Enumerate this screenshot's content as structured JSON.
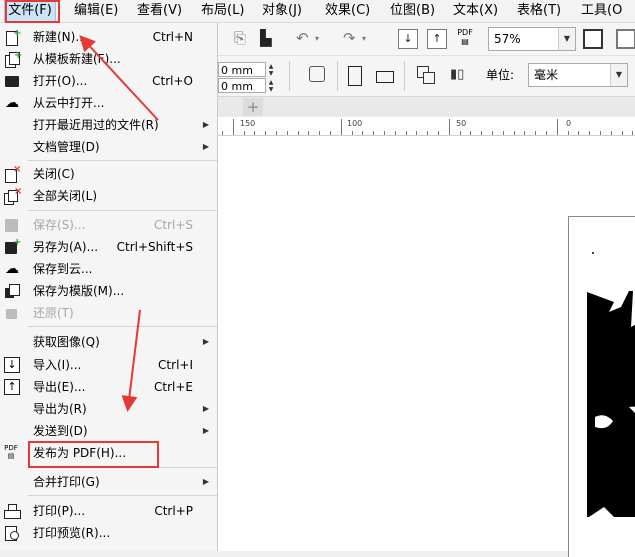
{
  "menubar": {
    "items": [
      "文件(F)",
      "编辑(E)",
      "查看(V)",
      "布局(L)",
      "对象(J)",
      "效果(C)",
      "位图(B)",
      "文本(X)",
      "表格(T)",
      "工具(O"
    ]
  },
  "toolbar": {
    "zoom": "57%",
    "width_value": "0 mm",
    "height_value": "0 mm",
    "units_label": "单位:",
    "units_value": "毫米",
    "pdf_label": "PDF"
  },
  "ruler": {
    "labels": [
      "150",
      "100",
      "50",
      "0"
    ]
  },
  "file_menu": {
    "items": [
      {
        "label": "新建(N)...",
        "shortcut": "Ctrl+N",
        "icon": "new-document-icon"
      },
      {
        "label": "从模板新建(F)...",
        "shortcut": "",
        "icon": "new-from-template-icon"
      },
      {
        "label": "打开(O)...",
        "shortcut": "Ctrl+O",
        "icon": "open-folder-icon"
      },
      {
        "label": "从云中打开...",
        "shortcut": "",
        "icon": "cloud-download-icon"
      },
      {
        "label": "打开最近用过的文件(R)",
        "shortcut": "",
        "submenu": true
      },
      {
        "label": "文档管理(D)",
        "shortcut": "",
        "submenu": true
      },
      {
        "label": "关闭(C)",
        "shortcut": "",
        "icon": "close-document-icon"
      },
      {
        "label": "全部关闭(L)",
        "shortcut": "",
        "icon": "close-all-icon"
      },
      {
        "label": "保存(S)...",
        "shortcut": "Ctrl+S",
        "icon": "save-icon",
        "disabled": true
      },
      {
        "label": "另存为(A)...",
        "shortcut": "Ctrl+Shift+S",
        "icon": "save-as-icon"
      },
      {
        "label": "保存到云...",
        "shortcut": "",
        "icon": "cloud-upload-icon"
      },
      {
        "label": "保存为模版(M)...",
        "shortcut": "",
        "icon": "save-template-icon"
      },
      {
        "label": "还原(T)",
        "shortcut": "",
        "icon": "revert-icon",
        "disabled": true
      },
      {
        "label": "获取图像(Q)",
        "shortcut": "",
        "submenu": true
      },
      {
        "label": "导入(I)...",
        "shortcut": "Ctrl+I",
        "icon": "import-icon"
      },
      {
        "label": "导出(E)...",
        "shortcut": "Ctrl+E",
        "icon": "export-icon"
      },
      {
        "label": "导出为(R)",
        "shortcut": "",
        "submenu": true
      },
      {
        "label": "发送到(D)",
        "shortcut": "",
        "submenu": true
      },
      {
        "label": "发布为 PDF(H)...",
        "shortcut": "",
        "icon": "pdf-icon",
        "icon_text": "PDF"
      },
      {
        "label": "合并打印(G)",
        "shortcut": "",
        "submenu": true
      },
      {
        "label": "打印(P)...",
        "shortcut": "Ctrl+P",
        "icon": "print-icon"
      },
      {
        "label": "打印预览(R)...",
        "shortcut": "",
        "icon": "print-preview-icon"
      }
    ]
  },
  "annotation_color": "#e53935"
}
